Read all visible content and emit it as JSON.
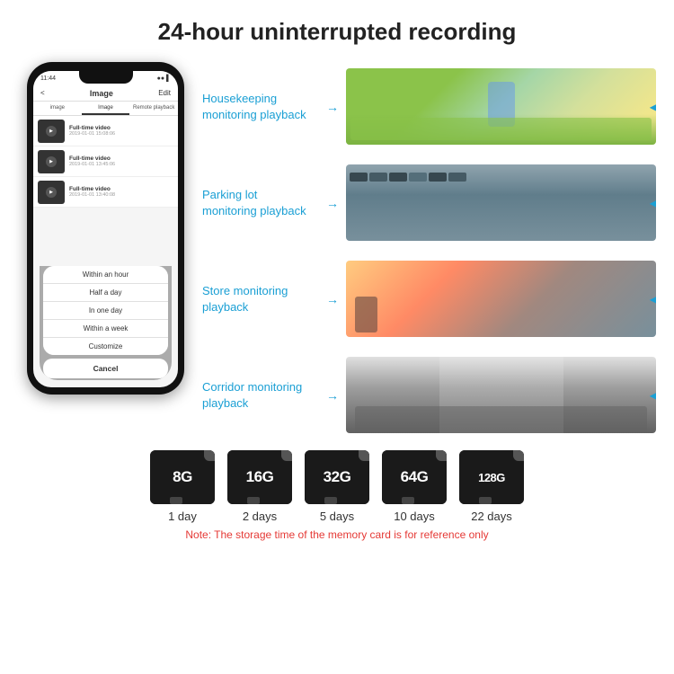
{
  "header": {
    "title": "24-hour uninterrupted recording"
  },
  "phone": {
    "status_bar": {
      "time": "11:44",
      "icons": "●● ▌▌"
    },
    "nav": {
      "back": "<",
      "title": "Image",
      "edit": "Edit"
    },
    "tabs": [
      "image",
      "Image",
      "Remote playback"
    ],
    "list_items": [
      {
        "title": "Full-time video",
        "date": "2019-01-01 15:08:06"
      },
      {
        "title": "Full-time video",
        "date": "2019-01-01 13:45:06"
      },
      {
        "title": "Full-time video",
        "date": "2019-01-01 13:40:08"
      }
    ],
    "popup": {
      "items": [
        "Within an hour",
        "Half a day",
        "In one day",
        "Within a week",
        "Customize"
      ],
      "cancel": "Cancel"
    }
  },
  "monitoring": [
    {
      "label": "Housekeeping\nmonitoring playback",
      "img_type": "housekeeping"
    },
    {
      "label": "Parking lot\nmonitoring playback",
      "img_type": "parking"
    },
    {
      "label": "Store monitoring\nplayback",
      "img_type": "store"
    },
    {
      "label": "Corridor monitoring\nplayback",
      "img_type": "corridor"
    }
  ],
  "storage": {
    "cards": [
      {
        "size": "8G",
        "days": "1 day"
      },
      {
        "size": "16G",
        "days": "2 days"
      },
      {
        "size": "32G",
        "days": "5 days"
      },
      {
        "size": "64G",
        "days": "10 days"
      },
      {
        "size": "128G",
        "days": "22 days"
      }
    ],
    "note": "Note: The storage time of the memory card is for reference only"
  },
  "colors": {
    "accent": "#1a9fd4",
    "title": "#222222",
    "note_red": "#e53935"
  }
}
